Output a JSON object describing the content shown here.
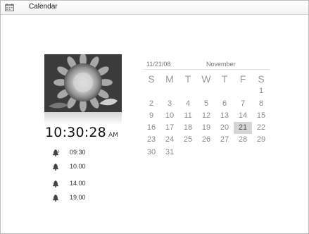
{
  "window": {
    "title": "Calendar",
    "icon": "calendar-icon"
  },
  "photo": {
    "icon": "sunflower-photo"
  },
  "clock": {
    "time": "10:30:28",
    "ampm": "AM"
  },
  "alarms": [
    {
      "time": "09:30",
      "icon": "bell-icon"
    },
    {
      "time": "10.00",
      "icon": "bell-icon"
    },
    {
      "time": "14.00",
      "icon": "bell-icon"
    },
    {
      "time": "19.00",
      "icon": "bell-icon"
    }
  ],
  "calendar": {
    "date": "11/21/08",
    "month": "November",
    "weekdays": [
      "S",
      "M",
      "T",
      "W",
      "T",
      "F",
      "S"
    ],
    "weeks": [
      [
        "",
        "",
        "",
        "",
        "",
        "",
        "1"
      ],
      [
        "2",
        "3",
        "4",
        "5",
        "6",
        "7",
        "8"
      ],
      [
        "9",
        "10",
        "11",
        "12",
        "13",
        "14",
        "15"
      ],
      [
        "16",
        "17",
        "18",
        "19",
        "20",
        "21",
        "22"
      ],
      [
        "23",
        "24",
        "25",
        "26",
        "27",
        "28",
        "29"
      ],
      [
        "30",
        "31",
        "",
        "",
        "",
        "",
        ""
      ]
    ],
    "selected_day": "21",
    "highlight_color": "#d6d6d6"
  }
}
